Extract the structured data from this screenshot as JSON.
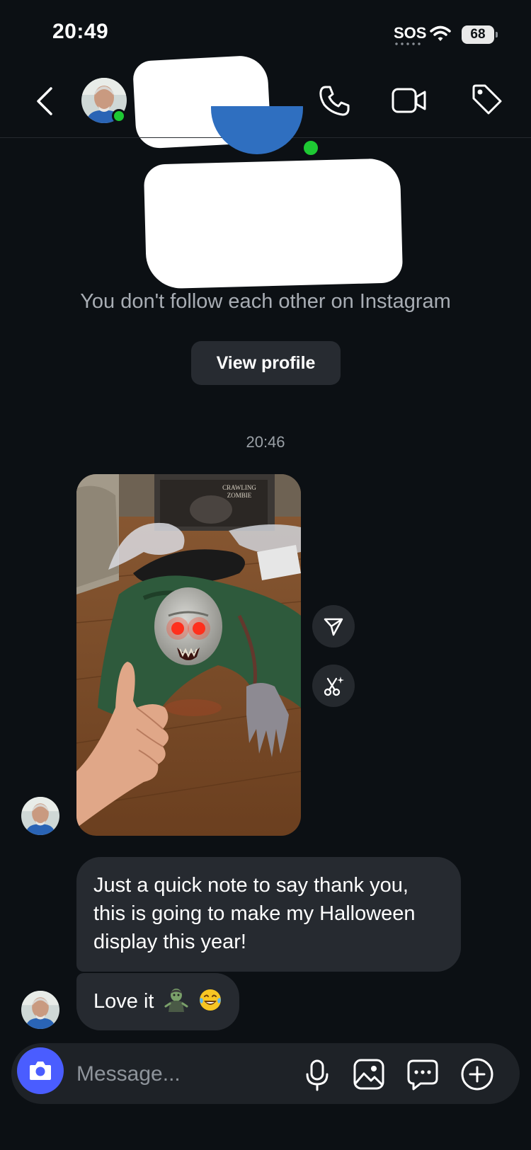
{
  "status_bar": {
    "time": "20:49",
    "sos": "SOS",
    "battery": "68"
  },
  "header": {
    "back_icon": "chevron-left-icon",
    "call_icon": "phone-icon",
    "video_icon": "video-camera-icon",
    "tag_icon": "tag-icon",
    "online_color": "#1ec933"
  },
  "profile": {
    "follow_note": "You don't follow each other on Instagram",
    "view_profile_label": "View profile"
  },
  "conversation": {
    "timestamp": "20:46",
    "media_alt": "Photo of crawling zombie Halloween prop on a wooden floor with a thumbs up",
    "media_box_text_1": "CRAWLING",
    "media_box_text_2": "ZOMBIE",
    "share_icon": "paper-plane-icon",
    "remix_icon": "scissors-sparkle-icon",
    "messages": [
      {
        "text": "Just a quick note to say thank you, this is going to make my Halloween display this year!"
      },
      {
        "text": "Love it",
        "emojis": [
          "zombie-emoji",
          "laughing-tears-emoji"
        ]
      }
    ]
  },
  "composer": {
    "placeholder": "Message...",
    "camera_icon": "camera-icon",
    "mic_icon": "microphone-icon",
    "gallery_icon": "image-icon",
    "sticker_icon": "sticker-chat-icon",
    "plus_icon": "plus-circle-icon",
    "accent": "#4a5dff"
  },
  "colors": {
    "background": "#0c1014",
    "bubble": "#262a30",
    "secondary_text": "#a8adb4"
  }
}
